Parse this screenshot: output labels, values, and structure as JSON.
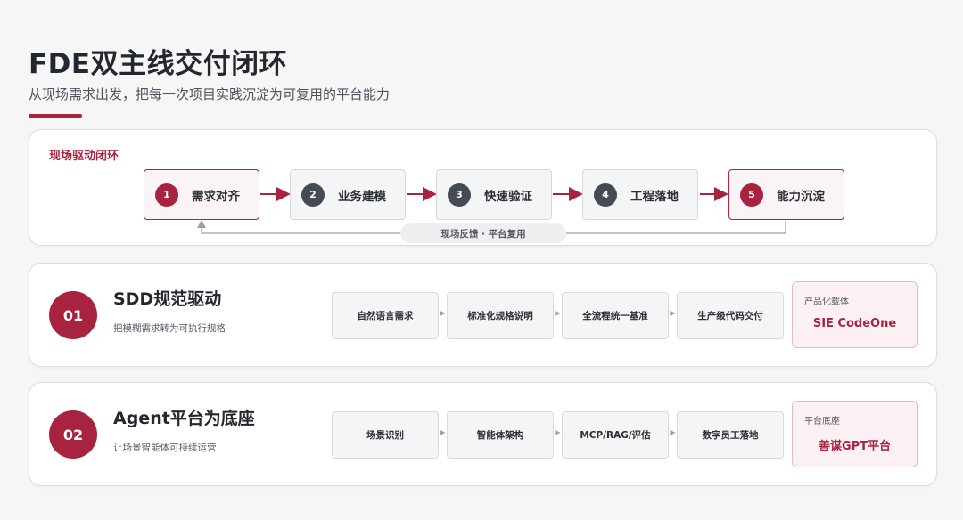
{
  "header": {
    "title": "FDE双主线交付闭环",
    "subtitle": "从现场需求出发，把每一次项目实践沉淀为可复用的平台能力"
  },
  "loop": {
    "title": "现场驱动闭环",
    "steps": [
      {
        "num": "1",
        "label": "需求对齐",
        "highlight": true
      },
      {
        "num": "2",
        "label": "业务建模",
        "highlight": false
      },
      {
        "num": "3",
        "label": "快速验证",
        "highlight": false
      },
      {
        "num": "4",
        "label": "工程落地",
        "highlight": false
      },
      {
        "num": "5",
        "label": "能力沉淀",
        "highlight": true
      }
    ],
    "feedback_label": "现场反馈 · 平台复用"
  },
  "rows": [
    {
      "badge": "01",
      "title": "SDD规范驱动",
      "desc": "把模糊需求转为可执行规格",
      "pills": [
        "自然语言需求",
        "标准化规格说明",
        "全流程统一基准",
        "生产级代码交付"
      ],
      "platform_caption": "产品化载体",
      "platform_name": "SIE CodeOne"
    },
    {
      "badge": "02",
      "title": "Agent平台为底座",
      "desc": "让场景智能体可持续运营",
      "pills": [
        "场景识别",
        "智能体架构",
        "MCP/RAG/评估",
        "数字员工落地"
      ],
      "platform_caption": "平台底座",
      "platform_name": "善谋GPT平台"
    }
  ],
  "colors": {
    "accent": "#a8233f",
    "step_badge": "#454b55",
    "card_bg": "#ffffff",
    "page_bg": "#f6f6f7"
  },
  "icons": {
    "pill_separator": "chevron-right-icon",
    "flow_arrow": "arrow-right-icon",
    "feedback_arrow": "arrow-up-icon"
  }
}
